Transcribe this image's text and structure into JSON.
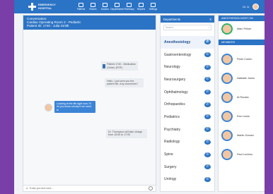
{
  "app": {
    "logo_line1": "EMERGENCY",
    "logo_line2": "HOSPITAL"
  },
  "nav": [
    {
      "label": "Patients",
      "icon": "patients-icon"
    },
    {
      "label": "Rooms",
      "icon": "rooms-icon"
    },
    {
      "label": "Doctors",
      "icon": "doctors-icon"
    },
    {
      "label": "Departments",
      "icon": "departments-icon"
    },
    {
      "label": "Pharmacy",
      "icon": "pharmacy-icon"
    },
    {
      "label": "Reports",
      "icon": "reports-icon"
    },
    {
      "label": "Settings",
      "icon": "settings-icon"
    }
  ],
  "topbar": {
    "user_short": "Dr. A."
  },
  "chat": {
    "line1": "Conversation:",
    "line2": "Cardiac Operating Room 2 - Pediatric",
    "line3": "Patient ID: 1740 - Julia Smith",
    "attachment_name": "Patient 1740 - Medication (Order)",
    "attachment_size": "PDF",
    "msg1": "Hello, I just sent you the patient file. Any comments?",
    "msg2": "Looking at the file right now. I'll let you know shortly if we need to",
    "msg3": "Dr. Thompson will take charge from 15:00 to 17:00",
    "input_placeholder": "Enter you text here..."
  },
  "departments": {
    "title": "Departments",
    "close": "X",
    "search_placeholder": "Search",
    "items": [
      {
        "label": "Anesthesiology",
        "active": true
      },
      {
        "label": "Gastroenterology"
      },
      {
        "label": "Neurology"
      },
      {
        "label": "Neurosurgery"
      },
      {
        "label": "Ophthalmology"
      },
      {
        "label": "Orthopaedics"
      },
      {
        "label": "Pediatrics"
      },
      {
        "label": "Psychiatry"
      },
      {
        "label": "Radiology"
      },
      {
        "label": "Spine"
      },
      {
        "label": "Surgery"
      },
      {
        "label": "Urology"
      }
    ]
  },
  "right": {
    "supervisor_title": "ANESTHESIOLOGIST ON",
    "supervisor_name": "Marc Peiser",
    "members_title": "MEMBERS",
    "members_count": "20",
    "members": [
      {
        "name": "Peter Cohen"
      },
      {
        "name": "Nathalie Jones"
      },
      {
        "name": "Al Rousta"
      },
      {
        "name": "Ron Lewis"
      },
      {
        "name": "Martin Gomez"
      },
      {
        "name": "Paul Lechino"
      }
    ]
  },
  "colors": {
    "primary": "#2b73c4",
    "accent_purple": "#7a3ea8"
  }
}
